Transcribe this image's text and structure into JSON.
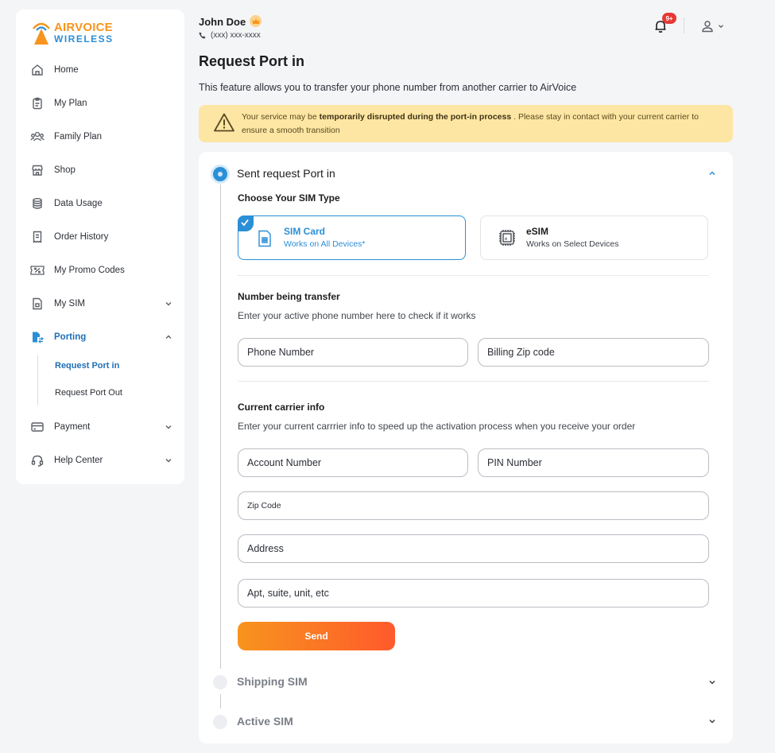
{
  "brand": {
    "line1": "AIRVOICE",
    "line2": "WIRELESS"
  },
  "sidebar": {
    "items": [
      {
        "label": "Home",
        "icon": "home-icon"
      },
      {
        "label": "My Plan",
        "icon": "clipboard-icon"
      },
      {
        "label": "Family Plan",
        "icon": "users-icon"
      },
      {
        "label": "Shop",
        "icon": "store-icon"
      },
      {
        "label": "Data Usage",
        "icon": "database-icon"
      },
      {
        "label": "Order History",
        "icon": "receipt-icon"
      },
      {
        "label": "My Promo Codes",
        "icon": "ticket-icon"
      },
      {
        "label": "My SIM",
        "icon": "sim-icon"
      },
      {
        "label": "Porting",
        "icon": "porting-icon"
      },
      {
        "label": "Payment",
        "icon": "card-icon"
      },
      {
        "label": "Help Center",
        "icon": "headset-icon"
      }
    ],
    "sub_items": [
      {
        "label": "Request Port in",
        "active": true
      },
      {
        "label": "Request Port Out",
        "active": false
      }
    ]
  },
  "header": {
    "user_name": "John Doe",
    "user_phone": "(xxx) xxx-xxxx",
    "notification_badge": "9+"
  },
  "page": {
    "title": "Request Port in",
    "description": "This feature allows you to transfer your phone number from another carrier to AirVoice"
  },
  "alert": {
    "prefix": "Your service may be ",
    "bold": "temporarily disrupted during the port-in process",
    "suffix": " . Please stay in contact with your current carrier to ensure a smooth transition",
    "color": "#fde6a3"
  },
  "steps": [
    {
      "title": "Sent request Port in",
      "state": "active"
    },
    {
      "title": "Shipping SIM",
      "state": "pending"
    },
    {
      "title": "Active SIM",
      "state": "pending"
    }
  ],
  "form": {
    "sim_type_title": "Choose Your SIM Type",
    "sim_options": [
      {
        "title": "SIM Card",
        "subtitle": "Works on All Devices*",
        "selected": true
      },
      {
        "title": "eSIM",
        "subtitle": "Works on Select Devices",
        "selected": false
      }
    ],
    "number_title": "Number being transfer",
    "number_subtitle": "Enter your active phone number here to check if it works",
    "phone_placeholder": "Phone Number",
    "billing_zip_placeholder": "Billing Zip code",
    "carrier_title": "Current carrier info",
    "carrier_subtitle": "Enter your current carrrier info to speed up the activation process when you receive your order",
    "account_placeholder": "Account Number",
    "pin_placeholder": "PIN Number",
    "zip_placeholder": "Zip Code",
    "address_placeholder": "Address",
    "apt_placeholder": "Apt, suite, unit, etc",
    "send_label": "Send"
  },
  "colors": {
    "accent": "#2a8fd6",
    "brand_orange": "#f7941d",
    "button_end": "#ff5a2c",
    "badge": "#e53935"
  }
}
